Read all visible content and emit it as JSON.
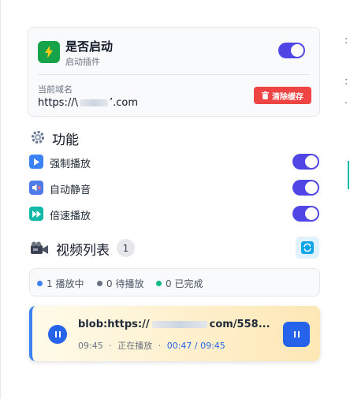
{
  "plugin": {
    "title": "是否启动",
    "subtitle": "启动插件",
    "enabled": true,
    "domain_label": "当前域名",
    "domain_prefix": "https://\\",
    "domain_suffix": "’.com",
    "clear_cache_label": "清除缓存"
  },
  "features": {
    "title": "功能",
    "items": [
      {
        "label": "强制播放",
        "enabled": true,
        "icon": "play-icon",
        "color": "#3b82f6"
      },
      {
        "label": "自动静音",
        "enabled": true,
        "icon": "mute-icon",
        "color": "#4f7be8"
      },
      {
        "label": "倍速播放",
        "enabled": true,
        "icon": "fast-forward-icon",
        "color": "#14b8a6"
      }
    ]
  },
  "video_list": {
    "title": "视频列表",
    "count": "1",
    "stats": [
      {
        "label": "1 播放中",
        "color": "#3b82f6"
      },
      {
        "label": "0 待播放",
        "color": "#6b7280"
      },
      {
        "label": "0 已完成",
        "color": "#10b981"
      }
    ],
    "videos": [
      {
        "url_prefix": "blob:https://",
        "url_suffix": "com/558...",
        "duration": "09:45",
        "status": "正在播放",
        "progress_text": "00:47 / 09:45"
      }
    ]
  },
  "colors": {
    "accent": "#4f46e5",
    "danger": "#ef4444",
    "primary": "#2563eb"
  }
}
